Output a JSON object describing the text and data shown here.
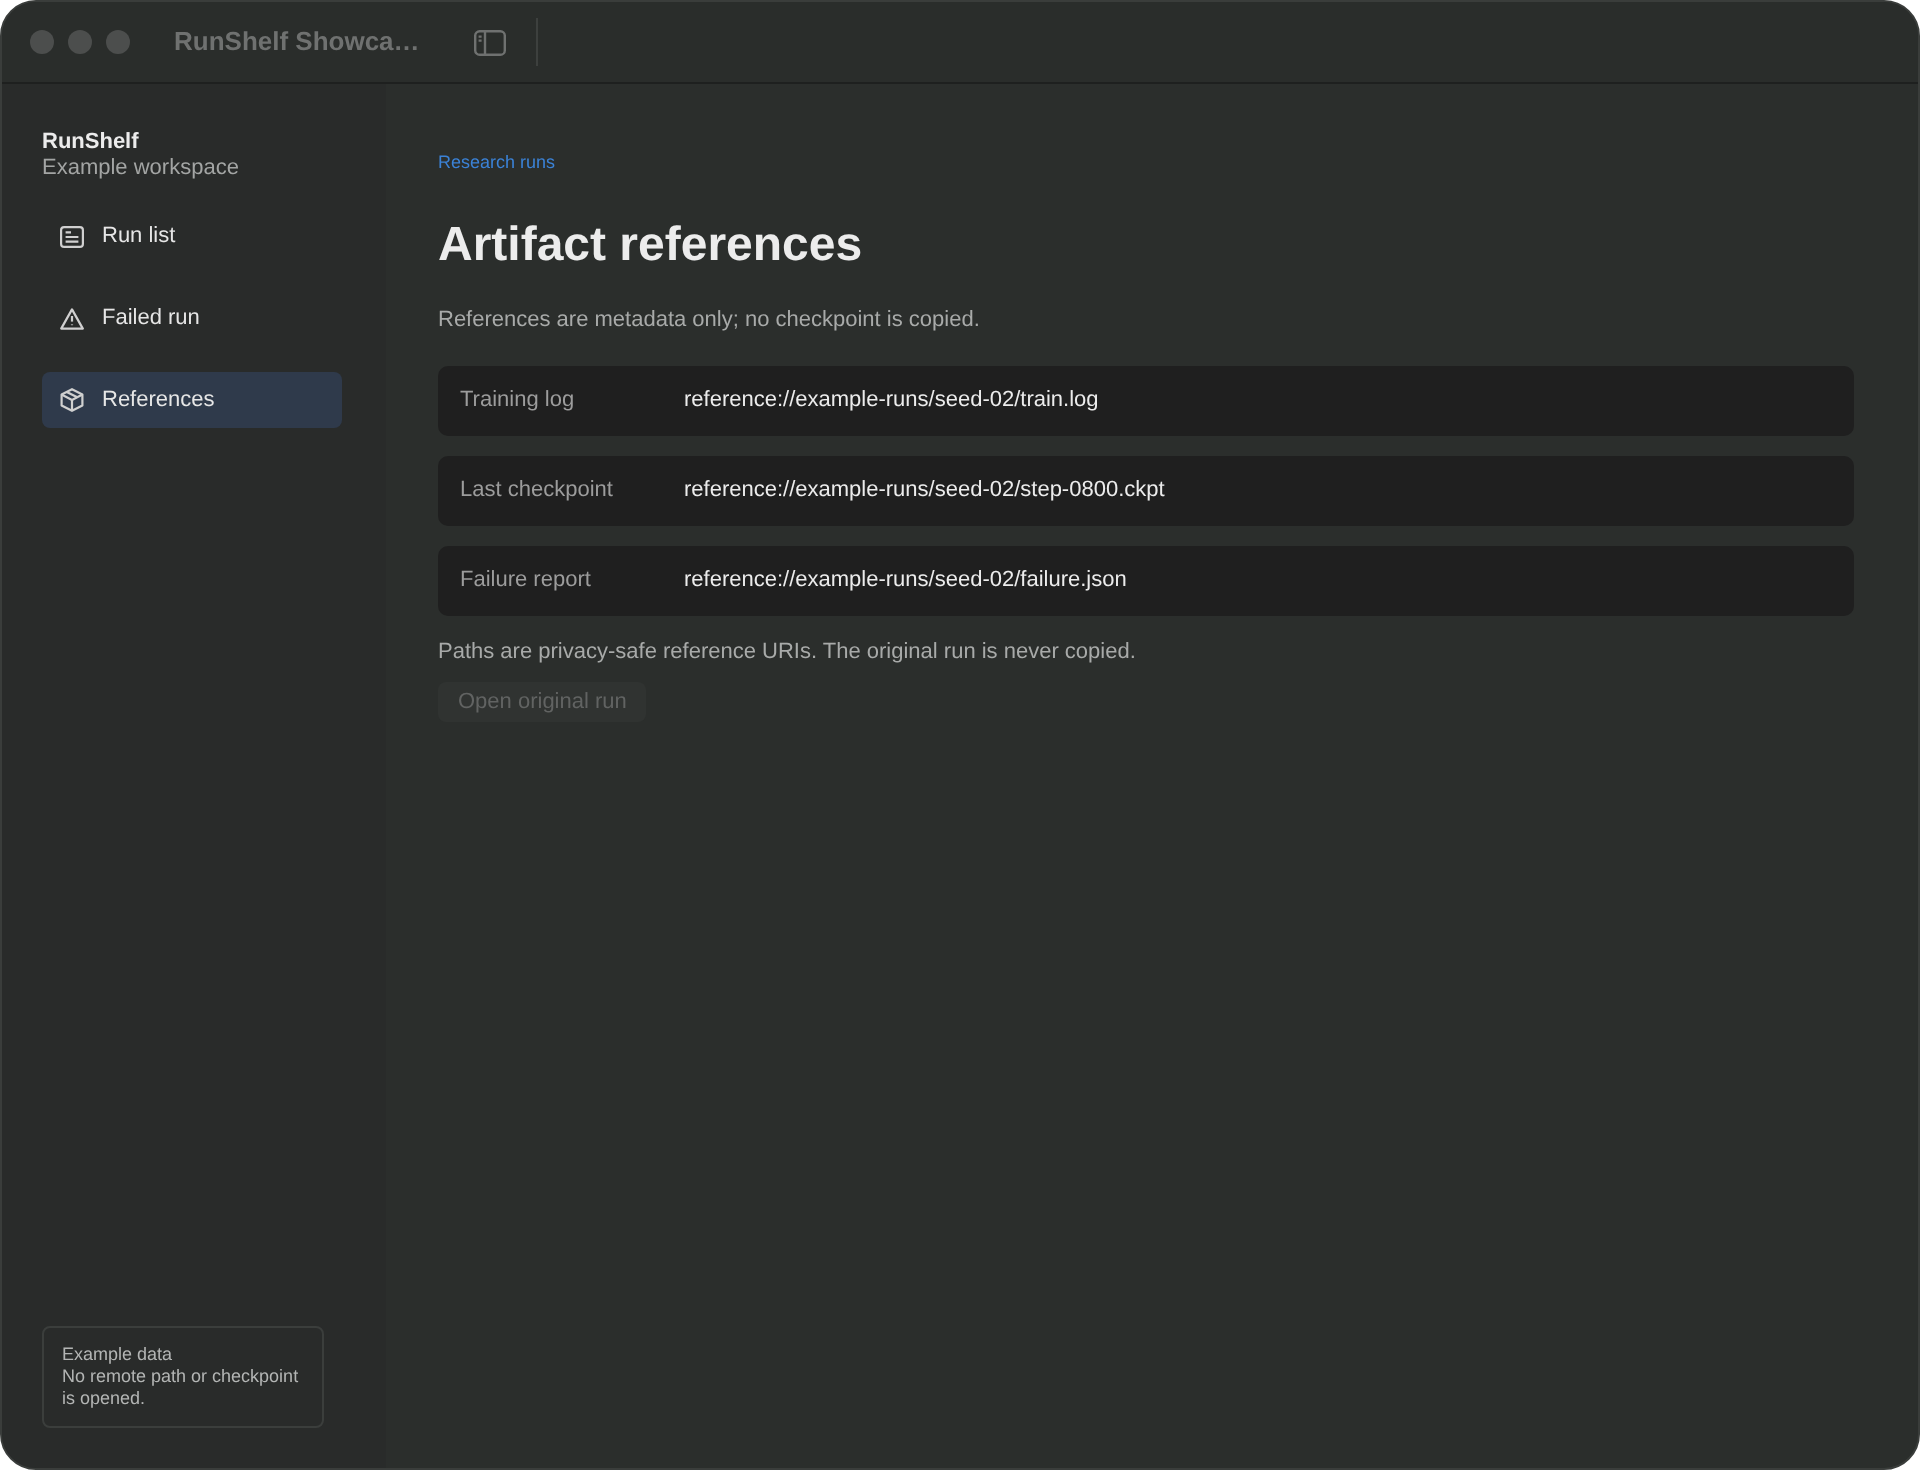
{
  "window": {
    "title": "RunShelf Showca…"
  },
  "sidebar": {
    "app_name": "RunShelf",
    "workspace": "Example workspace",
    "items": [
      {
        "label": "Run list",
        "kind": "list",
        "selected": false
      },
      {
        "label": "Failed run",
        "kind": "warning",
        "selected": false
      },
      {
        "label": "References",
        "kind": "package",
        "selected": true
      }
    ],
    "footer": {
      "title": "Example data",
      "text": "No remote path or checkpoint is opened."
    }
  },
  "main": {
    "breadcrumb": "Research runs",
    "title": "Artifact references",
    "description": "References are metadata only; no checkpoint is copied.",
    "references": [
      {
        "label": "Training log",
        "value": "reference://example-runs/seed-02/train.log"
      },
      {
        "label": "Last checkpoint",
        "value": "reference://example-runs/seed-02/step-0800.ckpt"
      },
      {
        "label": "Failure report",
        "value": "reference://example-runs/seed-02/failure.json"
      }
    ],
    "note": "Paths are privacy-safe reference URIs. The original run is never copied.",
    "button": {
      "label": "Open original run",
      "disabled": true
    }
  }
}
